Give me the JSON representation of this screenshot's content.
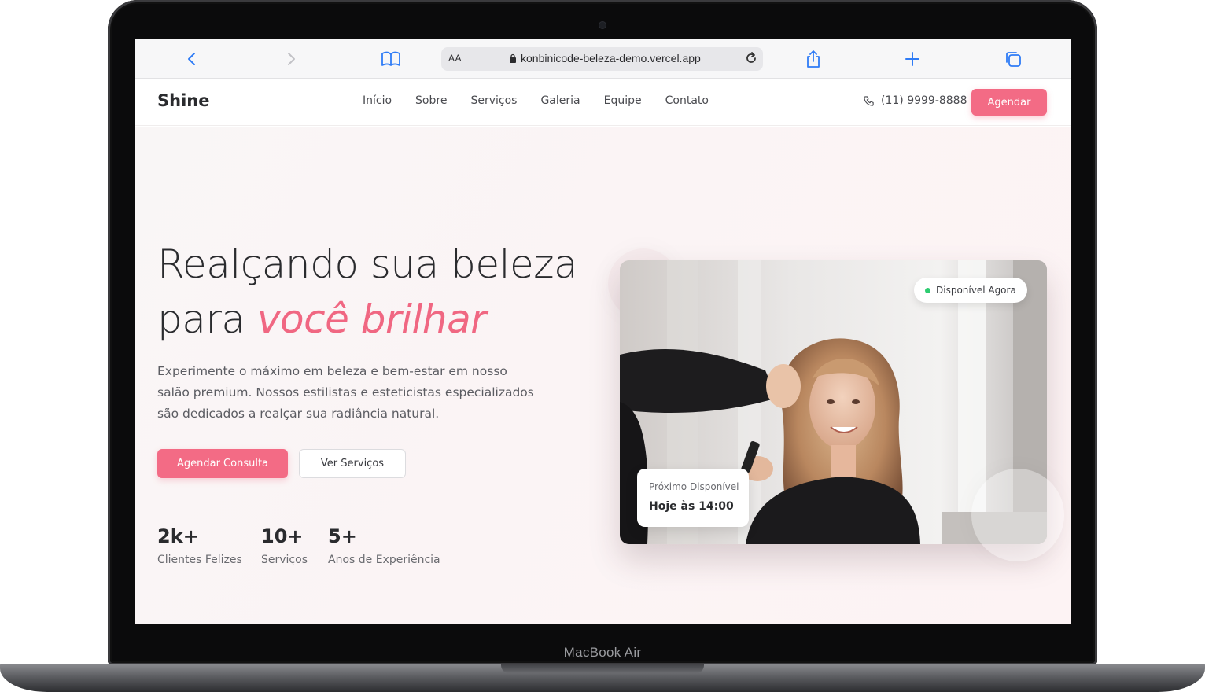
{
  "device": {
    "model_label": "MacBook Air"
  },
  "browser": {
    "text_size_label": "AA",
    "url": "konbinicode-beleza-demo.vercel.app"
  },
  "site": {
    "logo": "Shine",
    "nav": [
      "Início",
      "Sobre",
      "Serviços",
      "Galeria",
      "Equipe",
      "Contato"
    ],
    "phone": "(11) 9999-8888",
    "header_cta": "Agendar"
  },
  "hero": {
    "headline_line1": "Realçando sua beleza",
    "headline_line2_plain": "para ",
    "headline_line2_accent": "você brilhar",
    "subtext": "Experimente o máximo em beleza e bem-estar em nosso salão premium. Nossos estilistas e esteticistas especializados são dedicados a realçar sua radiância natural.",
    "primary_cta": "Agendar Consulta",
    "secondary_cta": "Ver Serviços",
    "stats": [
      {
        "value": "2k+",
        "label": "Clientes Felizes"
      },
      {
        "value": "10+",
        "label": "Serviços"
      },
      {
        "value": "5+",
        "label": "Anos de Experiência"
      }
    ],
    "availability_badge": "Disponível Agora",
    "next_available_label": "Próximo Disponível",
    "next_available_time": "Hoje às 14:00"
  },
  "colors": {
    "accent": "#f36b85",
    "accent_text": "#f06782",
    "status_green": "#2ecc71",
    "browser_blue": "#2f7cf6"
  },
  "icons": [
    "back-icon",
    "forward-icon",
    "bookmarks-icon",
    "lock-icon",
    "reload-icon",
    "share-icon",
    "new-tab-icon",
    "tabs-icon",
    "phone-icon"
  ]
}
